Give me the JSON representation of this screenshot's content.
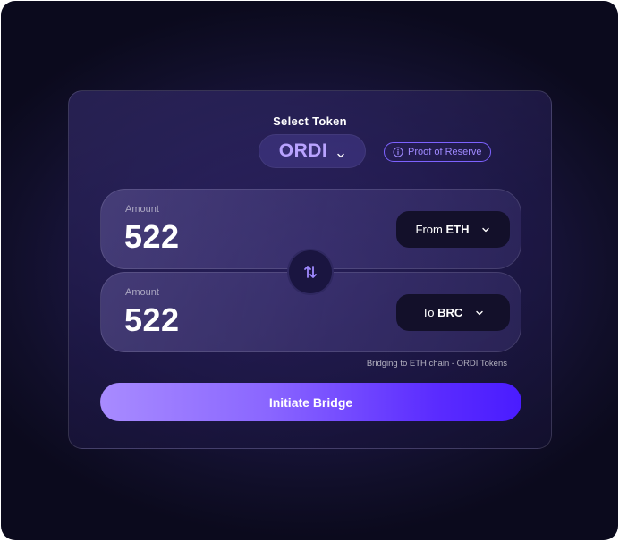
{
  "header": {
    "title": "Select Token"
  },
  "token": {
    "selected": "ORDI",
    "icon": "chevron-down-icon"
  },
  "proof": {
    "label": "Proof of Reserve",
    "icon": "info-icon"
  },
  "from": {
    "amount_label": "Amount",
    "amount": "522",
    "prefix": "From",
    "chain": "ETH"
  },
  "to": {
    "amount_label": "Amount",
    "amount": "522",
    "prefix": "To",
    "chain": "BRC"
  },
  "swap": {
    "icon": "swap-vertical-icon"
  },
  "note": "Bridging to ETH chain - ORDI Tokens",
  "cta": {
    "label": "Initiate Bridge"
  },
  "colors": {
    "accent": "#7d62ff",
    "token_text": "#b9a3ff",
    "cta_start": "#a88bff",
    "cta_end": "#4a1cff",
    "dark_button": "#13102a"
  }
}
